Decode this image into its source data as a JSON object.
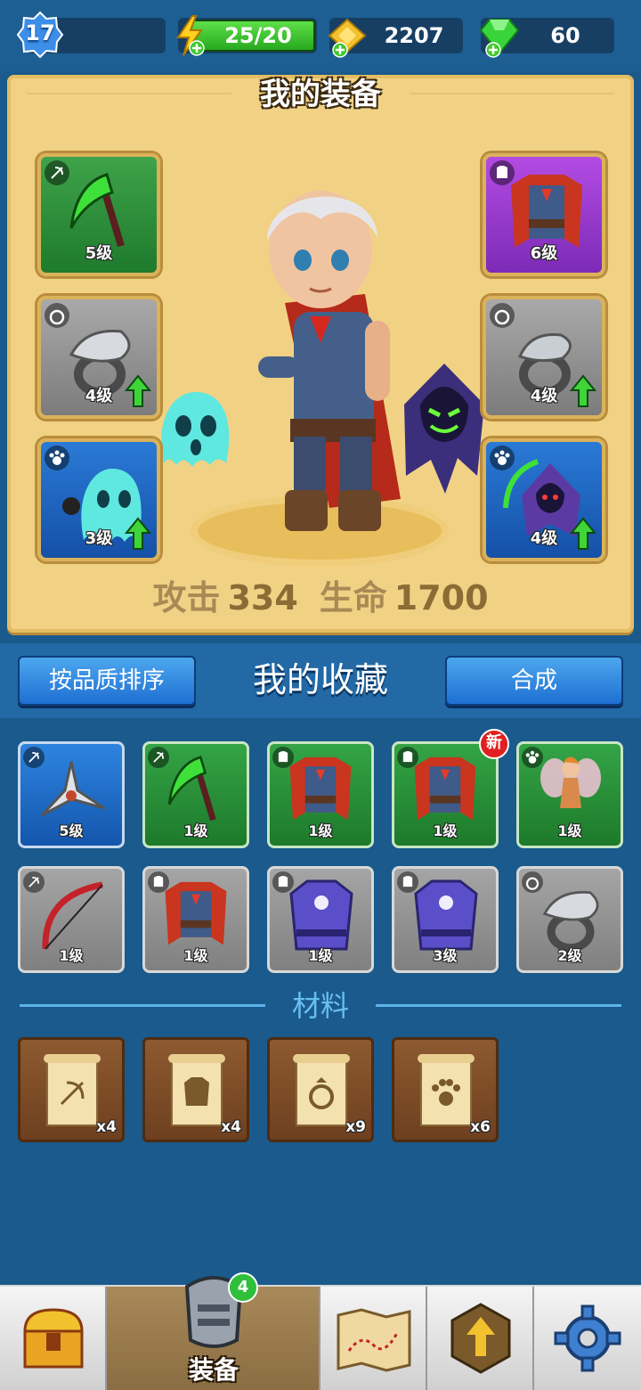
{
  "topbar": {
    "level": "17",
    "energy": "25/20",
    "gold": "2207",
    "gems": "60",
    "colors": {
      "energy": "#3fc92e",
      "gold": "#f2c12e",
      "gem": "#39d43a",
      "level": "#3c8ee8"
    }
  },
  "equipment": {
    "title": "我的装备",
    "slots": [
      {
        "name": "scythe",
        "type": "weapon",
        "level": "5级",
        "color": "green",
        "upgrade": false
      },
      {
        "name": "cape-armor",
        "type": "armor",
        "level": "6级",
        "color": "purple",
        "upgrade": false
      },
      {
        "name": "eagle-ring",
        "type": "ring",
        "level": "4级",
        "color": "grey",
        "upgrade": true
      },
      {
        "name": "serpent-ring",
        "type": "ring",
        "level": "4级",
        "color": "grey",
        "upgrade": true
      },
      {
        "name": "ghost-pet",
        "type": "pet",
        "level": "3级",
        "color": "blue",
        "upgrade": true
      },
      {
        "name": "reaper-pet",
        "type": "pet",
        "level": "4级",
        "color": "blue",
        "upgrade": true
      }
    ],
    "stats": {
      "attack_label": "攻击",
      "attack": "334",
      "hp_label": "生命",
      "hp": "1700"
    }
  },
  "collection": {
    "sort_button": "按品质排序",
    "title": "我的收藏",
    "merge_button": "合成",
    "new_badge": "新",
    "items": [
      {
        "name": "shuriken",
        "type": "weapon",
        "level": "5级",
        "color": "blue"
      },
      {
        "name": "scythe",
        "type": "weapon",
        "level": "1级",
        "color": "green"
      },
      {
        "name": "cape-armor",
        "type": "armor",
        "level": "1级",
        "color": "green"
      },
      {
        "name": "cape-armor",
        "type": "armor",
        "level": "1级",
        "color": "green",
        "new": true
      },
      {
        "name": "fairy-pet",
        "type": "pet",
        "level": "1级",
        "color": "green"
      },
      {
        "name": "bow",
        "type": "weapon",
        "level": "1级",
        "color": "grey"
      },
      {
        "name": "cape-armor",
        "type": "armor",
        "level": "1级",
        "color": "grey"
      },
      {
        "name": "mage-robe",
        "type": "armor",
        "level": "1级",
        "color": "grey"
      },
      {
        "name": "mage-robe",
        "type": "armor",
        "level": "3级",
        "color": "grey"
      },
      {
        "name": "eagle-ring",
        "type": "ring",
        "level": "2级",
        "color": "grey"
      }
    ]
  },
  "materials": {
    "title": "材料",
    "items": [
      {
        "name": "weapon-scroll",
        "count": "x4"
      },
      {
        "name": "armor-scroll",
        "count": "x4"
      },
      {
        "name": "ring-scroll",
        "count": "x9"
      },
      {
        "name": "pet-scroll",
        "count": "x6"
      }
    ]
  },
  "nav": {
    "active_label": "装备",
    "badge": "4",
    "tabs": [
      "chest-icon",
      "armor-icon",
      "map-icon",
      "upgrade-icon",
      "gear-icon"
    ]
  }
}
